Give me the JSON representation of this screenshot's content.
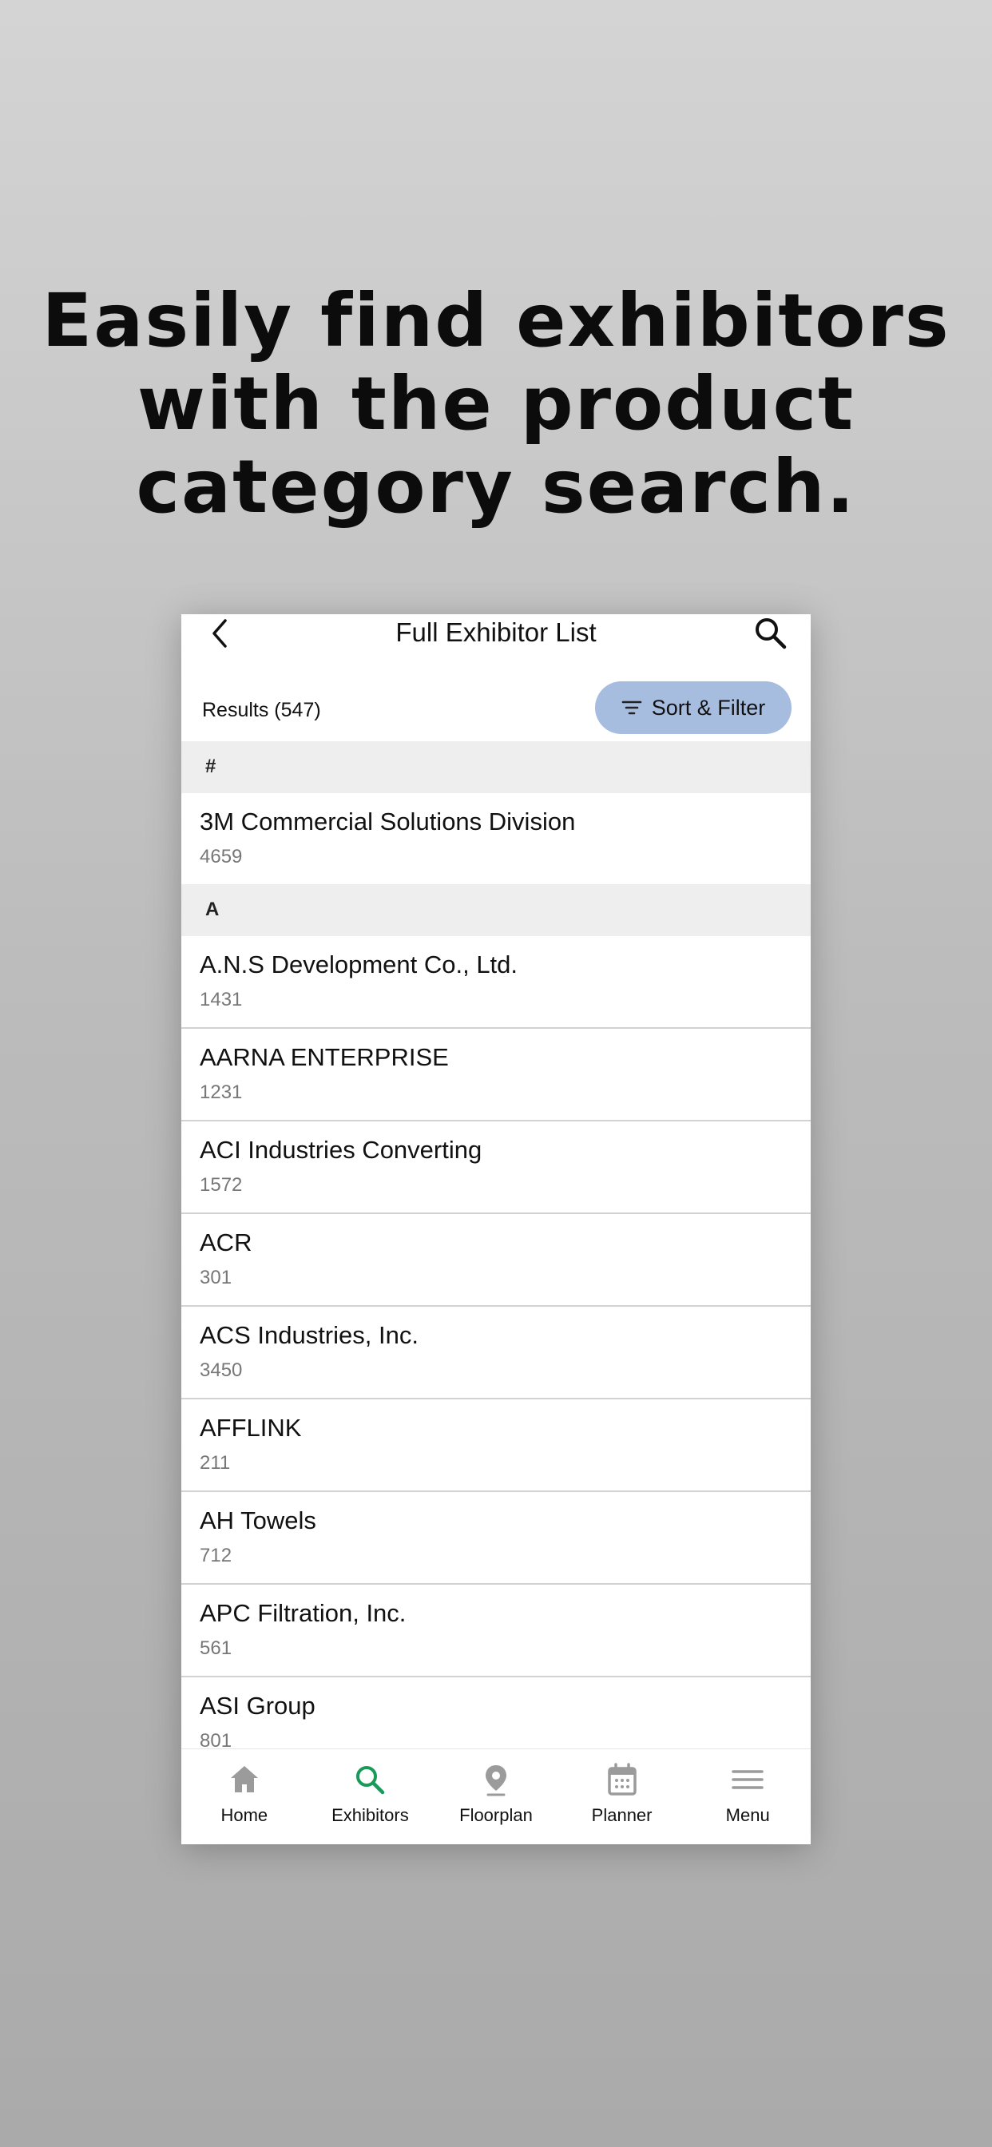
{
  "promo": {
    "headline_lines": [
      "Easily find exhibitors",
      "with the product",
      "category search."
    ]
  },
  "navbar": {
    "title": "Full Exhibitor List",
    "back_icon": "chevron-left-icon",
    "search_icon": "search-icon"
  },
  "toolbar": {
    "results_label": "Results (547)",
    "sort_filter_label": "Sort & Filter",
    "sort_filter_icon": "filter-lines-icon",
    "sort_filter_color": "#a7bddf"
  },
  "list": {
    "sections": [
      {
        "header": "#",
        "items": [
          {
            "name": "3M Commercial Solutions Division",
            "booth": "4659"
          }
        ]
      },
      {
        "header": "A",
        "items": [
          {
            "name": "A.N.S Development Co., Ltd.",
            "booth": "1431"
          },
          {
            "name": "AARNA ENTERPRISE",
            "booth": "1231"
          },
          {
            "name": "ACI Industries Converting",
            "booth": "1572"
          },
          {
            "name": "ACR",
            "booth": "301"
          },
          {
            "name": "ACS Industries, Inc.",
            "booth": "3450"
          },
          {
            "name": "AFFLINK",
            "booth": "211"
          },
          {
            "name": "AH Towels",
            "booth": "712"
          },
          {
            "name": "APC Filtration, Inc.",
            "booth": "561"
          },
          {
            "name": "ASI Group",
            "booth": "801"
          }
        ]
      }
    ]
  },
  "tabbar": {
    "active_color": "#1a9a5a",
    "inactive_icon_color": "#9b9b9b",
    "tabs": [
      {
        "label": "Home",
        "icon": "home-icon",
        "active": false
      },
      {
        "label": "Exhibitors",
        "icon": "search-icon",
        "active": true
      },
      {
        "label": "Floorplan",
        "icon": "map-pin-icon",
        "active": false
      },
      {
        "label": "Planner",
        "icon": "calendar-icon",
        "active": false
      },
      {
        "label": "Menu",
        "icon": "hamburger-menu-icon",
        "active": false
      }
    ]
  }
}
